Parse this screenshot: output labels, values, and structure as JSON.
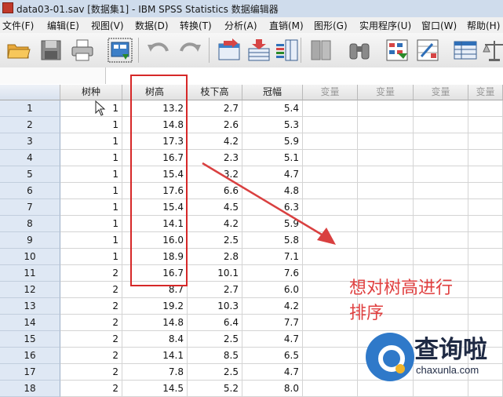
{
  "window": {
    "title": "data03-01.sav [数据集1] - IBM SPSS Statistics 数据编辑器"
  },
  "menu": [
    "文件(F)",
    "编辑(E)",
    "视图(V)",
    "数据(D)",
    "转换(T)",
    "分析(A)",
    "直销(M)",
    "图形(G)",
    "实用程序(U)",
    "窗口(W)",
    "帮助(H)"
  ],
  "toolbar": {
    "icons": [
      "open-folder-icon",
      "save-icon",
      "print-icon",
      "dialog-recall-icon",
      "undo-icon",
      "redo-icon",
      "goto-case-icon",
      "insert-cases-icon",
      "insert-variable-icon",
      "split-file-icon",
      "find-icon",
      "select-cases-icon",
      "weight-cases-icon",
      "value-labels-icon",
      "scale-icon"
    ]
  },
  "grid": {
    "columns": [
      "树种",
      "树高",
      "枝下高",
      "冠幅",
      "变量",
      "变量",
      "变量",
      "变量"
    ],
    "rows": [
      [
        "1",
        "1",
        "13.2",
        "2.7",
        "5.4"
      ],
      [
        "2",
        "1",
        "14.8",
        "2.6",
        "5.3"
      ],
      [
        "3",
        "1",
        "17.3",
        "4.2",
        "5.9"
      ],
      [
        "4",
        "1",
        "16.7",
        "2.3",
        "5.1"
      ],
      [
        "5",
        "1",
        "15.4",
        "3.2",
        "4.7"
      ],
      [
        "6",
        "1",
        "17.6",
        "6.6",
        "4.8"
      ],
      [
        "7",
        "1",
        "15.4",
        "4.5",
        "6.3"
      ],
      [
        "8",
        "1",
        "14.1",
        "4.2",
        "5.9"
      ],
      [
        "9",
        "1",
        "16.0",
        "2.5",
        "5.8"
      ],
      [
        "10",
        "1",
        "18.9",
        "2.8",
        "7.1"
      ],
      [
        "11",
        "2",
        "16.7",
        "10.1",
        "7.6"
      ],
      [
        "12",
        "2",
        "8.7",
        "2.7",
        "6.0"
      ],
      [
        "13",
        "2",
        "19.2",
        "10.3",
        "4.2"
      ],
      [
        "14",
        "2",
        "14.8",
        "6.4",
        "7.7"
      ],
      [
        "15",
        "2",
        "8.4",
        "2.5",
        "4.7"
      ],
      [
        "16",
        "2",
        "14.1",
        "8.5",
        "6.5"
      ],
      [
        "17",
        "2",
        "7.8",
        "2.5",
        "4.7"
      ],
      [
        "18",
        "2",
        "14.5",
        "5.2",
        "8.0"
      ]
    ]
  },
  "annotation": {
    "line1": "想对树高进行",
    "line2": "排序",
    "color": "#e04040"
  },
  "watermark": {
    "brand": "查询啦",
    "url": "chaxunla.com"
  }
}
